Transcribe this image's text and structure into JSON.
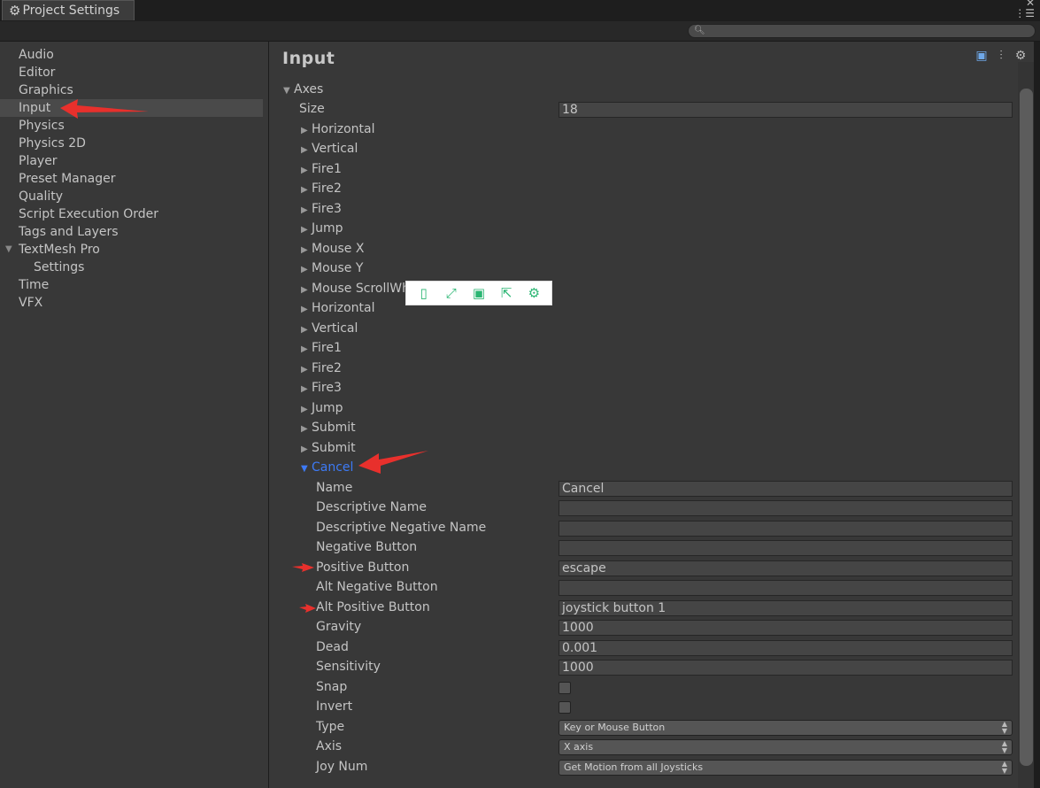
{
  "window": {
    "tab_title": "Project Settings",
    "tab_icon": "gear-icon",
    "controls": "✕",
    "menu_icon": "⋮☰"
  },
  "search": {
    "placeholder": ""
  },
  "sidebar": {
    "items": [
      {
        "label": "Audio"
      },
      {
        "label": "Editor"
      },
      {
        "label": "Graphics"
      },
      {
        "label": "Input",
        "selected": true
      },
      {
        "label": "Physics"
      },
      {
        "label": "Physics 2D"
      },
      {
        "label": "Player"
      },
      {
        "label": "Preset Manager"
      },
      {
        "label": "Quality"
      },
      {
        "label": "Script Execution Order"
      },
      {
        "label": "Tags and Layers"
      },
      {
        "label": "TextMesh Pro",
        "expanded": true
      },
      {
        "label": "Settings",
        "child": true
      },
      {
        "label": "Time"
      },
      {
        "label": "VFX"
      }
    ]
  },
  "main": {
    "title": "Input",
    "header_icons": [
      "help-icon",
      "preset-icon",
      "settings-icon"
    ],
    "axes_label": "Axes",
    "size_label": "Size",
    "size_value": "18",
    "axes": [
      "Horizontal",
      "Vertical",
      "Fire1",
      "Fire2",
      "Fire3",
      "Jump",
      "Mouse X",
      "Mouse Y",
      "Mouse ScrollWheel",
      "Horizontal",
      "Vertical",
      "Fire1",
      "Fire2",
      "Fire3",
      "Jump",
      "Submit",
      "Submit",
      "Cancel"
    ],
    "expanded_axis": "Cancel",
    "properties": {
      "name": {
        "label": "Name",
        "value": "Cancel"
      },
      "descriptive_name": {
        "label": "Descriptive Name",
        "value": ""
      },
      "descriptive_negative_name": {
        "label": "Descriptive Negative Name",
        "value": ""
      },
      "negative_button": {
        "label": "Negative Button",
        "value": ""
      },
      "positive_button": {
        "label": "Positive Button",
        "value": "escape"
      },
      "alt_negative_button": {
        "label": "Alt Negative Button",
        "value": ""
      },
      "alt_positive_button": {
        "label": "Alt Positive Button",
        "value": "joystick button 1"
      },
      "gravity": {
        "label": "Gravity",
        "value": "1000"
      },
      "dead": {
        "label": "Dead",
        "value": "0.001"
      },
      "sensitivity": {
        "label": "Sensitivity",
        "value": "1000"
      },
      "snap": {
        "label": "Snap",
        "checked": false
      },
      "invert": {
        "label": "Invert",
        "checked": false
      },
      "type": {
        "label": "Type",
        "value": "Key or Mouse Button"
      },
      "axis": {
        "label": "Axis",
        "value": "X axis"
      },
      "joy_num": {
        "label": "Joy Num",
        "value": "Get Motion from all Joysticks"
      }
    }
  },
  "floating_toolbar": {
    "icons": [
      "tablet-icon",
      "expand-icon",
      "save-icon",
      "share-icon",
      "gear-icon"
    ],
    "color": "#2bb673"
  },
  "colors": {
    "background": "#383838",
    "active_text": "#3d7af5",
    "annotation_arrow": "#e8302c"
  }
}
